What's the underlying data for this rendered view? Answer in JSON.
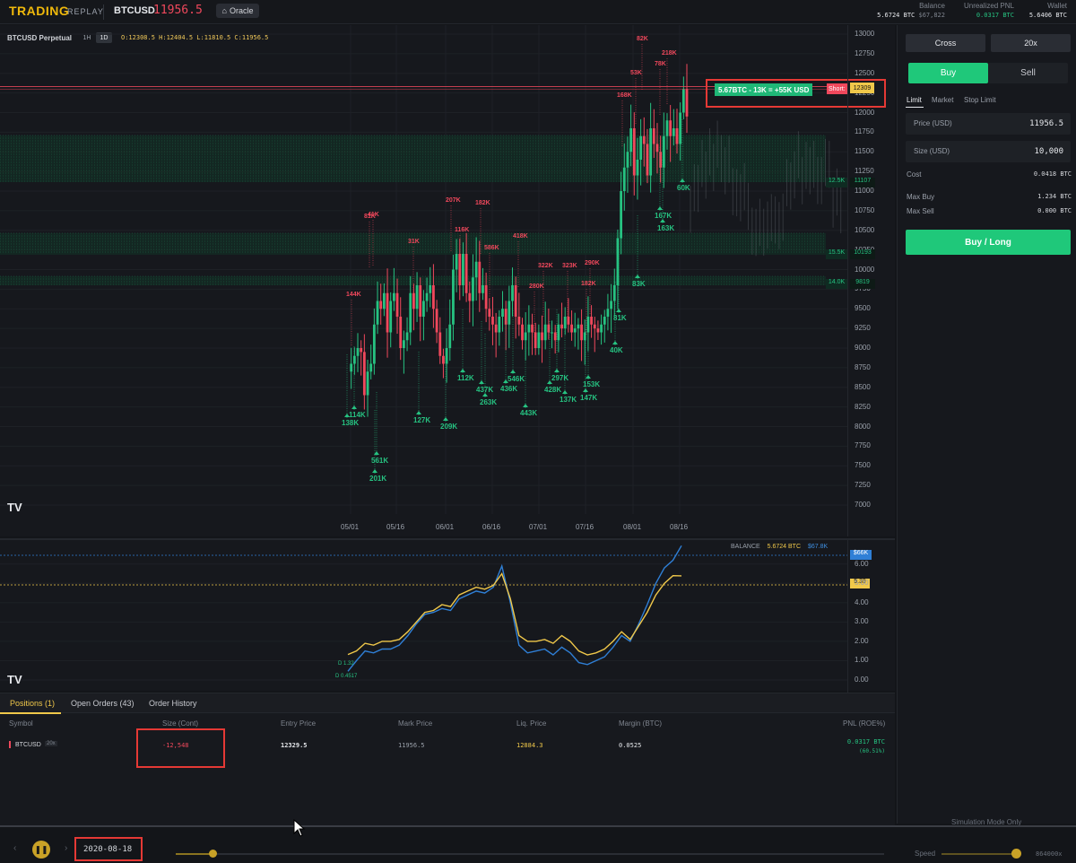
{
  "header": {
    "brand": "TRADING",
    "brand_sub": "REPLAY",
    "symbol": "BTCUSD",
    "price": "11956.5",
    "oracle_label": "Oracle",
    "stats": [
      {
        "label": "Balance",
        "value": "5.6724 BTC",
        "sub": "$67,822"
      },
      {
        "label": "Unrealized PNL",
        "value": "0.0317 BTC"
      },
      {
        "label": "Wallet",
        "value": "5.6406 BTC"
      }
    ]
  },
  "chart": {
    "title": "BTCUSD Perpetual",
    "timeframes": [
      "1H",
      "1D"
    ],
    "active_timeframe": "1D",
    "ohlc": "O:12308.5  H:12404.5  L:11810.5  C:11956.5",
    "price_ticks": [
      "13000",
      "12750",
      "12500",
      "12250",
      "12000",
      "11750",
      "11500",
      "11250",
      "11000",
      "10750",
      "10500",
      "10250",
      "10000",
      "9750",
      "9500",
      "9250",
      "9000",
      "8750",
      "8500",
      "8250",
      "8000",
      "7750",
      "7500",
      "7250",
      "7000"
    ],
    "date_ticks": [
      "05/01",
      "05/16",
      "06/01",
      "06/16",
      "07/01",
      "07/16",
      "08/01",
      "08/16"
    ],
    "position_label": "5.67BTC - 13K = +55K USD",
    "short_tag": "Short:",
    "short_price": "12309",
    "level_labels": [
      {
        "vol": "12.5K",
        "price": "11107"
      },
      {
        "vol": "15.5K",
        "price": "10193"
      },
      {
        "vol": "14.0K",
        "price": "9819"
      }
    ],
    "annotations_sell": [
      "82K",
      "218K",
      "78K",
      "53K",
      "168K",
      "207K",
      "81K",
      "182K",
      "41K",
      "116K",
      "586K",
      "418K",
      "31K",
      "280K",
      "322K",
      "323K",
      "290K",
      "182K",
      "144K"
    ],
    "annotations_buy": [
      "561K",
      "201K",
      "138K",
      "114K",
      "127K",
      "209K",
      "112K",
      "437K",
      "263K",
      "546K",
      "436K",
      "443K",
      "428K",
      "297K",
      "137K",
      "153K",
      "147K",
      "81K",
      "163K",
      "167K",
      "60K",
      "40K",
      "83K"
    ]
  },
  "balance_chart": {
    "legend_label": "BALANCE",
    "legend_btc": "5.6724 BTC",
    "legend_usd": "$67.8K",
    "usd_tag": "$66K",
    "btc_tag": "5.39",
    "ticks": [
      "6.00",
      "5.00",
      "4.00",
      "3.00",
      "2.00",
      "1.00",
      "0.00"
    ],
    "start_labels": [
      "D 1.32",
      "D 0.4517"
    ]
  },
  "positions": {
    "tabs": [
      "Positions (1)",
      "Open Orders (43)",
      "Order History"
    ],
    "columns": [
      "Symbol",
      "Size (Cont)",
      "Entry Price",
      "Mark Price",
      "Liq. Price",
      "Margin (BTC)",
      "PNL (ROE%)"
    ],
    "row": {
      "symbol": "BTCUSD",
      "leverage": "20x",
      "size": "-12,548",
      "entry": "12329.5",
      "mark": "11956.5",
      "liq": "12884.3",
      "margin": "0.0525",
      "pnl": "0.0317 BTC",
      "roe": "(60.51%)"
    }
  },
  "order_panel": {
    "margin_mode": "Cross",
    "leverage": "20x",
    "buy_label": "Buy",
    "sell_label": "Sell",
    "order_types": [
      "Limit",
      "Market",
      "Stop Limit"
    ],
    "price_label": "Price (USD)",
    "price_value": "11956.5",
    "size_label": "Size (USD)",
    "size_value": "10,000",
    "cost_label": "Cost",
    "cost_value": "0.0418 BTC",
    "max_buy_label": "Max Buy",
    "max_buy_value": "1.234 BTC",
    "max_sell_label": "Max Sell",
    "max_sell_value": "0.000 BTC",
    "submit_label": "Buy / Long",
    "sim_label": "Simulation Mode Only"
  },
  "playback": {
    "date": "2020-08-18",
    "speed_label": "Speed",
    "speed_value": "864000x"
  },
  "colors": {
    "up": "#26c281",
    "down": "#f0485c",
    "accent": "#f0b90b",
    "buy": "#1fc87a"
  }
}
